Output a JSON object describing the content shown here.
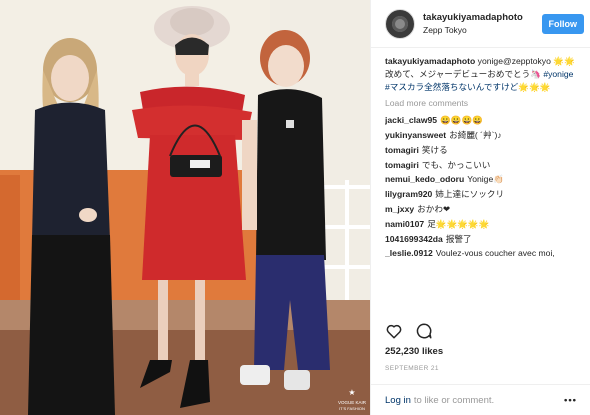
{
  "header": {
    "username": "takayukiyamadaphoto",
    "location": "Zepp Tokyo",
    "follow_label": "Follow"
  },
  "caption": {
    "user": "takayukiyamadaphoto",
    "text": " yonige@zepptokyo 🌟🌟 改めて、メジャーデビューおめでとう🦄 ",
    "tag1": "#yonige",
    "tag2": " #マスカラ全然落ちないんですけど🌟🌟🌟"
  },
  "load_more": "Load more comments",
  "comments": [
    {
      "user": "jacki_claw95",
      "text": "😀😀😀😀"
    },
    {
      "user": "yukinyansweet",
      "text": "お綺麗( ´艸`)♪"
    },
    {
      "user": "tomagiri",
      "text": "笑ける"
    },
    {
      "user": "tomagiri",
      "text": "でも、かっこいい"
    },
    {
      "user": "nemui_kedo_odoru",
      "text": "Yonige👏🏻"
    },
    {
      "user": "lilygram920",
      "text": "姉上達にソックリ"
    },
    {
      "user": "m_jxxy",
      "text": "おかわ❤"
    },
    {
      "user": "nami0107",
      "text": "足🌟🌟🌟🌟🌟"
    },
    {
      "user": "1041699342da",
      "text": "报警了"
    },
    {
      "user": "_leslie.0912",
      "text": "Voulez-vous coucher avec moi,"
    }
  ],
  "likes": "252,230 likes",
  "date": "SEPTEMBER 21",
  "login": {
    "link": "Log in",
    "rest": "to like or comment.",
    "more": "•••"
  },
  "watermark": "VOGUE KAIR IT'S FASHION",
  "colors": {
    "accent": "#3897f0",
    "link": "#003569",
    "muted": "#999999",
    "wall": "#efe8da",
    "orange_backdrop": "#e07a3c"
  }
}
